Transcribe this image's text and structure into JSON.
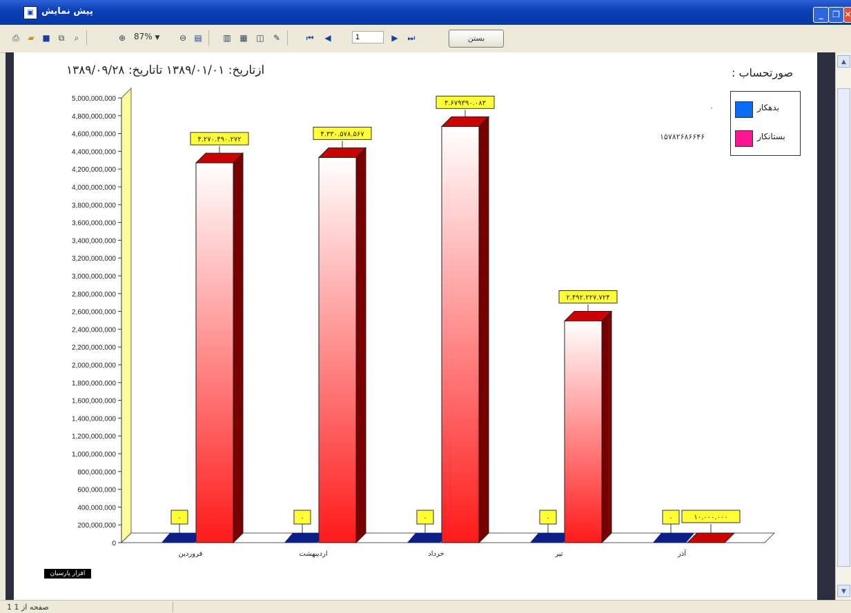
{
  "window": {
    "title": "پیش نمایش"
  },
  "toolbar": {
    "zoom": "87%",
    "page_input": "1",
    "close_label": "بستن",
    "icons": [
      "print-icon",
      "open-folder-icon",
      "save-icon",
      "export-icon",
      "find-icon",
      "zoom-in-icon",
      "zoom-dropdown",
      "zoom-out-icon",
      "fit-page-icon",
      "single-page-icon",
      "two-page-icon",
      "book-icon",
      "edit-icon",
      "first-page-icon",
      "previous-page-icon",
      "next-page-icon",
      "last-page-icon"
    ]
  },
  "report": {
    "date_range": "ازتاریخ: ۱۳۸۹/۰۱/۰۱ تاتاریخ: ۱۳۸۹/۰۹/۲۸",
    "account_label": "صورتحساب :",
    "logo_text": "افزار پارسیان"
  },
  "legend": [
    {
      "label": "بدهکار",
      "value": "۰",
      "color": "#0a6cf5"
    },
    {
      "label": "بستانکار",
      "value": "۱۵۷۸۲۶۸۶۶۴۶",
      "color": "#ff1493"
    }
  ],
  "status": {
    "page_text": "1 صفحه از 1"
  },
  "chart_data": {
    "type": "bar",
    "categories": [
      "فروردین",
      "اردیبهشت",
      "خرداد",
      "تیر",
      "آذر"
    ],
    "series": [
      {
        "name": "بدهکار",
        "values": [
          0,
          0,
          0,
          0,
          0
        ],
        "labels": [
          "۰",
          "۰",
          "۰",
          "۰",
          "۰"
        ],
        "color": "#0b1f8a"
      },
      {
        "name": "بستانکار",
        "values": [
          4270490272,
          4330578567,
          4679390083,
          2492227724,
          10000000
        ],
        "labels": [
          "۴.۲۷۰.۴۹۰.۲۷۲",
          "۴.۳۳۰.۵۷۸.۵۶۷",
          "۴.۶۷۹۳۹۰.۰۸۳",
          "۲.۴۹۲.۲۲۷.۷۲۴",
          "۱۰.۰۰۰.۰۰۰"
        ],
        "color": "#e01010"
      }
    ],
    "ylim": [
      0,
      5000000000
    ],
    "ytick_step": 200000000,
    "grid": false
  }
}
